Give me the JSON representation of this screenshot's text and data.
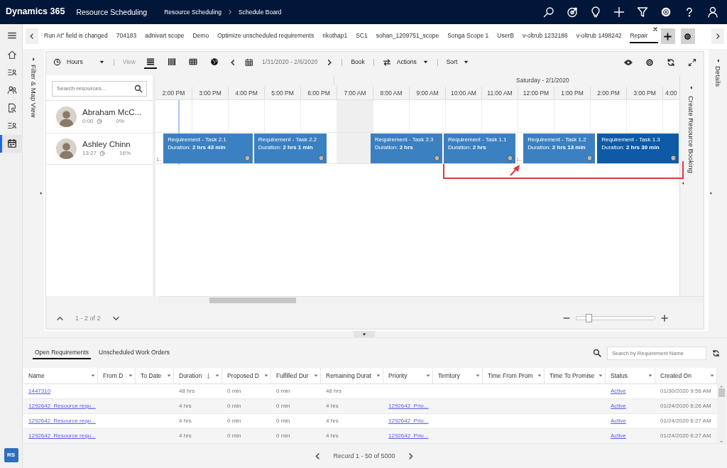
{
  "app_bar": {
    "brand": "Dynamics 365",
    "app_name": "Resource Scheduling",
    "breadcrumb": [
      "Resource Scheduling",
      "Schedule Board"
    ]
  },
  "nav_rail": {
    "items": [
      {
        "selected": false
      },
      {
        "selected": false
      },
      {
        "selected": false
      },
      {
        "selected": false
      },
      {
        "selected": false
      },
      {
        "selected": true
      }
    ],
    "user_badge": "RS"
  },
  "board_tabs": [
    {
      "label": "Run At” field is changed",
      "selected": false
    },
    {
      "label": "704183",
      "selected": false
    },
    {
      "label": "adnivart scope",
      "selected": false
    },
    {
      "label": "Demo",
      "selected": false
    },
    {
      "label": "Optimize unscheduled requirements",
      "selected": false
    },
    {
      "label": "rikothap1",
      "selected": false
    },
    {
      "label": "SC1",
      "selected": false
    },
    {
      "label": "sohan_1209751_scope",
      "selected": false
    },
    {
      "label": "Songa Scope 1",
      "selected": false
    },
    {
      "label": "UserB",
      "selected": false
    },
    {
      "label": "v-oltrub 1232186",
      "selected": false
    },
    {
      "label": "v-oltrub 1498242",
      "selected": false
    },
    {
      "label": "Repair",
      "selected": true
    }
  ],
  "filter_panel": {
    "label": "Filter & Map View"
  },
  "toolbar": {
    "scale": "Hours",
    "view_label": "View",
    "views": [
      {
        "selected": true
      },
      {
        "selected": false
      },
      {
        "selected": false
      },
      {
        "selected": false
      }
    ],
    "date_range": "1/31/2020 - 2/6/2020",
    "book": "Book",
    "actions": "Actions",
    "sort": "Sort"
  },
  "resource_search": {
    "placeholder": "Search resources..."
  },
  "timeline": {
    "day_label": "Saturday - 2/1/2020",
    "hours": [
      {
        "label": "2:00 PM",
        "off_hours": false
      },
      {
        "label": "3:00 PM",
        "off_hours": false
      },
      {
        "label": "4:00 PM",
        "off_hours": false
      },
      {
        "label": "5:00 PM",
        "off_hours": false
      },
      {
        "label": "6:00 PM",
        "off_hours": false
      },
      {
        "label": "7:00 AM",
        "off_hours": true
      },
      {
        "label": "8:00 AM",
        "off_hours": false
      },
      {
        "label": "9:00 AM",
        "off_hours": false
      },
      {
        "label": "10:00 AM",
        "off_hours": false
      },
      {
        "label": "11:00 AM",
        "off_hours": false
      },
      {
        "label": "12:00 PM",
        "off_hours": false
      },
      {
        "label": "1:00 PM",
        "off_hours": false
      },
      {
        "label": "2:00 PM",
        "off_hours": false
      },
      {
        "label": "3:00 PM",
        "off_hours": false
      },
      {
        "label": "4:00",
        "off_hours": false
      }
    ]
  },
  "resources": [
    {
      "name": "Abraham McC...",
      "hours": "0:00",
      "utilization": "0%"
    },
    {
      "name": "Ashley Chinn",
      "hours": "13:27",
      "utilization": "16%",
      "bookings": [
        {
          "kind": "travel",
          "label": "1..."
        },
        {
          "kind": "booking",
          "title": "Requirement - Task 2.1",
          "duration": "Duration: **2 hrs 43 min**",
          "selected": false
        },
        {
          "kind": "booking",
          "title": "Requirement - Task 2.2",
          "duration": "Duration: **2 hrs 1 min**",
          "selected": false
        },
        {
          "kind": "booking",
          "title": "Requirement - Task 2.3",
          "duration": "Duration: **2 hrs**",
          "selected": false
        },
        {
          "kind": "booking",
          "title": "Requirement - Task 1.1",
          "duration": "Duration: **2 hrs**",
          "selected": false
        },
        {
          "kind": "travel",
          "label": "1..."
        },
        {
          "kind": "booking",
          "title": "Requirement - Task 1.2",
          "duration": "Duration: **2 hrs 13 min**",
          "selected": false
        },
        {
          "kind": "booking",
          "title": "Requirement - Task 1.3",
          "duration": "Duration: **2 hrs 30 min**",
          "selected": true
        }
      ]
    }
  ],
  "resource_pager": "1 - 2 of 2",
  "zoom": {
    "level": 0.15
  },
  "create_panel": {
    "label": "Create Resource Booking"
  },
  "details_panel": {
    "label": "Details"
  },
  "requirements": {
    "tabs": [
      {
        "label": "Open Requirements",
        "selected": true
      },
      {
        "label": "Unscheduled Work Orders",
        "selected": false
      }
    ],
    "search": {
      "placeholder": "Search by Requirement Name"
    },
    "columns": [
      {
        "label": "Name",
        "kind": "link",
        "sorted": false
      },
      {
        "label": "From D",
        "kind": "text",
        "sorted": false
      },
      {
        "label": "To Date",
        "kind": "text",
        "sorted": false
      },
      {
        "label": "Duration",
        "kind": "text",
        "sorted": true
      },
      {
        "label": "Proposed D",
        "kind": "text",
        "sorted": false
      },
      {
        "label": "Fulfilled Dur",
        "kind": "text",
        "sorted": false
      },
      {
        "label": "Remaining Durat",
        "kind": "text",
        "sorted": false
      },
      {
        "label": "Priority",
        "kind": "link",
        "sorted": false
      },
      {
        "label": "Territory",
        "kind": "text",
        "sorted": false
      },
      {
        "label": "Time From Prom",
        "kind": "text",
        "sorted": false
      },
      {
        "label": "Time To Promise",
        "kind": "text",
        "sorted": false
      },
      {
        "label": "Status",
        "kind": "link",
        "sorted": false
      },
      {
        "label": "Created On",
        "kind": "text",
        "sorted": false
      }
    ],
    "rows": [
      [
        "1447310",
        null,
        null,
        "48 hrs",
        "0 min",
        "0 min",
        "48 hrs",
        null,
        null,
        null,
        null,
        "Active",
        "01/30/2020 9:56 AM"
      ],
      [
        "1292642_Resource requ...",
        null,
        null,
        "4 hrs",
        "0 min",
        "0 min",
        "4 hrs",
        "1292642_Prio...",
        null,
        null,
        null,
        "Active",
        "01/24/2020 6:26 AM"
      ],
      [
        "1292642_Resource requ...",
        null,
        null,
        "4 hrs",
        "0 min",
        "0 min",
        "4 hrs",
        "1292642_Prio...",
        null,
        null,
        null,
        "Active",
        "01/24/2020 6:27 AM"
      ],
      [
        "1292642_Resource requ...",
        null,
        null,
        "4 hrs",
        "0 min",
        "0 min",
        "4 hrs",
        "1292642_Prio...",
        null,
        null,
        null,
        "Active",
        "01/24/2020 6:27 AM"
      ]
    ],
    "footer": "Record 1 - 50 of 5000"
  }
}
